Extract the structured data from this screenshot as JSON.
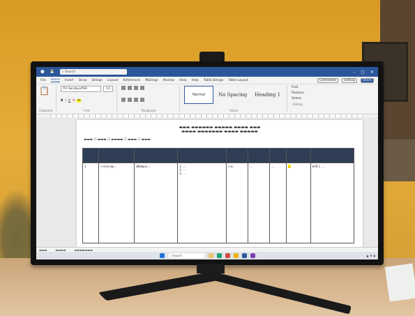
{
  "word": {
    "search_placeholder": "Search",
    "menu": [
      "File",
      "Home",
      "Insert",
      "Draw",
      "Design",
      "Layout",
      "References",
      "Mailings",
      "Review",
      "View",
      "Help",
      "Table Design",
      "Table Layout"
    ],
    "menu_right": [
      "Comments",
      "Editing",
      "Share"
    ],
    "font_name": "TH SarabunPSK",
    "font_size": "14",
    "styles": [
      "Normal",
      "No Spacing",
      "Heading 1"
    ],
    "editing": [
      "Find",
      "Replace",
      "Select"
    ],
    "group_labels": [
      "Clipboard",
      "Font",
      "Paragraph",
      "Styles",
      "Editing"
    ]
  },
  "document": {
    "table_rows": [
      {
        "c1": "1",
        "c2": "การประชุม...",
        "c3": "เพื่อพัฒนา...",
        "c4": "1. ...\n2. ...\n3. ...",
        "c5": "ก.พ.",
        "c6": "...",
        "c7": "...",
        "c8": "...",
        "c9": "ดังนี้ 1. ..."
      }
    ]
  },
  "taskbar": {
    "search_label": "Search"
  },
  "colors": {
    "word_blue": "#2b579a",
    "table_header": "#2f3e55",
    "wall": "#e0a42e"
  }
}
